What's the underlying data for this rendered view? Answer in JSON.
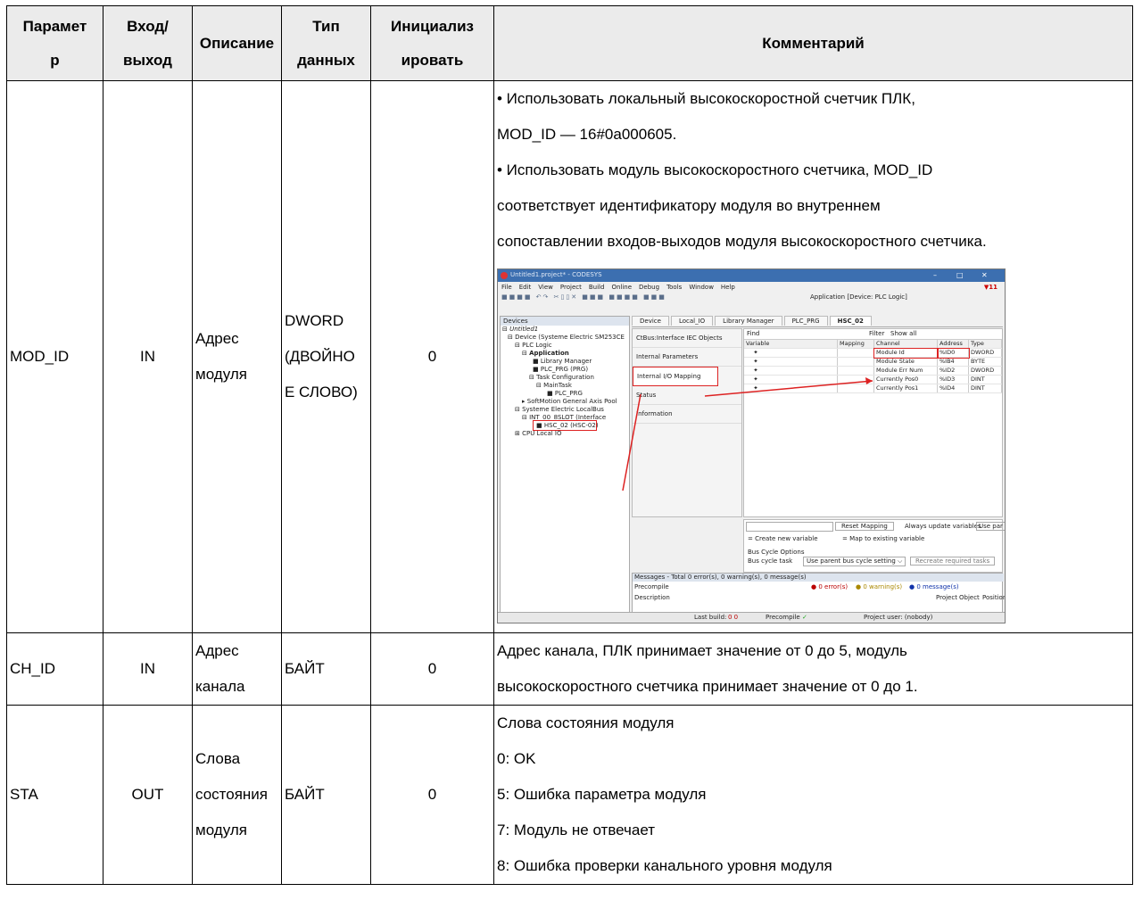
{
  "headers": {
    "param": [
      "Парамет",
      "р"
    ],
    "io": [
      "Вход/",
      "выход"
    ],
    "desc": "Описание",
    "dtype": [
      "Тип",
      "данных"
    ],
    "init": [
      "Инициализ",
      "ировать"
    ],
    "comment": "Комментарий"
  },
  "rows": [
    {
      "param": "MOD_ID",
      "io": "IN",
      "desc": [
        "Адрес",
        "модуля"
      ],
      "dtype": [
        "DWORD",
        "(ДВОЙНО",
        "Е СЛОВО)"
      ],
      "init": "0",
      "comment": [
        "• Использовать локальный высокоскоростной счетчик ПЛК,",
        "MOD_ID — 16#0a000605.",
        "• Использовать модуль высокоскоростного счетчика, MOD_ID",
        "соответствует идентификатору модуля во внутреннем",
        "сопоставлении входов-выходов модуля высокоскоростного счетчика."
      ]
    },
    {
      "param": "CH_ID",
      "io": "IN",
      "desc": [
        "Адрес",
        "канала"
      ],
      "dtype": "БАЙТ",
      "init": "0",
      "comment": [
        "Адрес канала, ПЛК принимает значение от 0 до 5, модуль",
        "высокоскоростного счетчика принимает значение от 0 до 1."
      ]
    },
    {
      "param": "STA",
      "io": "OUT",
      "desc": [
        "Слова",
        "состояния",
        "модуля"
      ],
      "dtype": "БАЙТ",
      "init": "0",
      "comment": [
        "Слова состояния модуля",
        "0: OK",
        "5: Ошибка параметра модуля",
        "7: Модуль не отвечает",
        "8: Ошибка проверки канального уровня модуля"
      ]
    }
  ],
  "screenshot": {
    "title": "Untitled1.project* - CODESYS",
    "menu": [
      "File",
      "Edit",
      "View",
      "Project",
      "Build",
      "Online",
      "Debug",
      "Tools",
      "Window",
      "Help"
    ],
    "app_selector": "Application [Device: PLC Logic]",
    "flag_count": "11",
    "devices_title": "Devices",
    "tree": [
      "Untitled1",
      "Device (Systeme Electric SM253CE",
      "PLC Logic",
      "Application",
      "Library Manager",
      "PLC_PRG (PRG)",
      "Task Configuration",
      "MainTask",
      "PLC_PRG",
      "SoftMotion General Axis Pool",
      "Systeme Electric LocalBus",
      "INT_00_8SLOT (Interface",
      "HSC_02 (HSC-02)",
      "CPU Local IO"
    ],
    "tabs": [
      "Device",
      "Local_IO",
      "Library Manager",
      "PLC_PRG",
      "HSC_02"
    ],
    "left_items": [
      "CtBus:Interface IEC Objects",
      "Internal Parameters",
      "Internal I/O Mapping",
      "Status",
      "Information"
    ],
    "find_label": "Find",
    "filter_label": "Filter",
    "show_all": "Show all",
    "columns": [
      "Variable",
      "Mapping",
      "Channel",
      "Address",
      "Type"
    ],
    "io_rows": [
      [
        "Module Id",
        "%ID0",
        "DWORD"
      ],
      [
        "Module State",
        "%IB4",
        "BYTE"
      ],
      [
        "Module Err Num",
        "%ID2",
        "DWORD"
      ],
      [
        "Currently Pos0",
        "%ID3",
        "DINT"
      ],
      [
        "Currently Pos1",
        "%ID4",
        "DINT"
      ]
    ],
    "reset_mapping": "Reset Mapping",
    "always_update": "Always update variables",
    "use_par": "Use par",
    "create_var": "= Create new variable",
    "map_var": "= Map to existing variable",
    "bus_cycle_options": "Bus Cycle Options",
    "bus_cycle_task": "Bus cycle task",
    "bus_cycle_value": "Use parent bus cycle setting",
    "recreate_tasks": "Recreate required tasks",
    "messages_title": "Messages - Total 0 error(s), 0 warning(s), 0 message(s)",
    "precompile": "Precompile",
    "errors": "0 error(s)",
    "warnings": "0 warning(s)",
    "messages": "0 message(s)",
    "description": "Description",
    "msg_cols": [
      "Project",
      "Object",
      "Position"
    ],
    "last_build": "Last build:",
    "build_counts": "0   0",
    "precompile_ok": "Precompile",
    "project_user": "Project user: (nobody)"
  }
}
